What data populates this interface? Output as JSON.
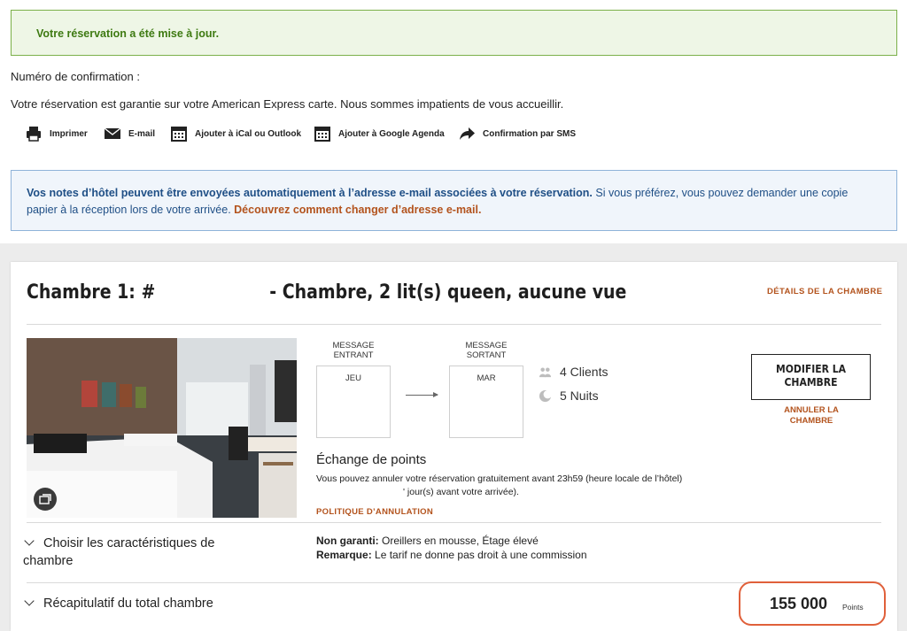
{
  "success_message": "Votre réservation a été mise à jour.",
  "confirmation_label": "Numéro de confirmation :",
  "guarantee_text": "Votre réservation est garantie sur votre American Express carte. Nous sommes impatients de vous accueillir.",
  "actions": [
    {
      "label": "Imprimer",
      "icon": "printer-icon"
    },
    {
      "label": "E-mail",
      "icon": "envelope-icon"
    },
    {
      "label": "Ajouter à iCal ou Outlook",
      "icon": "calendar-icon"
    },
    {
      "label": "Ajouter à Google Agenda",
      "icon": "calendar-icon"
    },
    {
      "label": "Confirmation par SMS",
      "icon": "share-arrow-icon"
    }
  ],
  "info_banner": {
    "bold_text": "Vos notes d’hôtel peuvent être envoyées automatiquement à l’adresse e-mail associées à votre réservation.",
    "text": " Si vous préférez, vous pouvez demander une copie papier à la réception lors de votre arrivée. ",
    "link": "Découvrez comment changer d’adresse e-mail."
  },
  "room": {
    "title_prefix": "Chambre 1: #",
    "title_suffix": "- Chambre, 2 lit(s) queen, aucune vue",
    "details_link": "DÉTAILS DE LA CHAMBRE",
    "checkin_label": "MESSAGE ENTRANT",
    "checkin_day": "JEU",
    "checkout_label": "MESSAGE SORTANT",
    "checkout_day": "MAR",
    "guests": "4 Clients",
    "nights": "5 Nuits",
    "modify_button": "MODIFIER LA CHAMBRE",
    "cancel_link": "ANNULER LA CHAMBRE",
    "exchange_title": "Échange de points",
    "cancel_policy_line1": "Vous pouvez annuler votre réservation gratuitement avant 23h59 (heure locale de l’hôtel)",
    "cancel_policy_line2": "' jour(s) avant votre arrivée).",
    "policy_link": "POLITIQUE D’ANNULATION",
    "features_toggle": "Choisir les caractéristiques de chambre",
    "not_guaranteed_label": "Non garanti:",
    "not_guaranteed_value": " Oreillers en mousse, Étage élevé",
    "remark_label": "Remarque:",
    "remark_value": " Le tarif ne donne pas droit à une commission",
    "summary_toggle": "Récapitulatif du total chambre",
    "total_points": "155 000",
    "points_unit": "Points"
  },
  "colors": {
    "success_text": "#3e7a12",
    "info_text": "#1f4f86",
    "accent_link": "#b3531d",
    "highlight_circle": "#e0603a"
  }
}
